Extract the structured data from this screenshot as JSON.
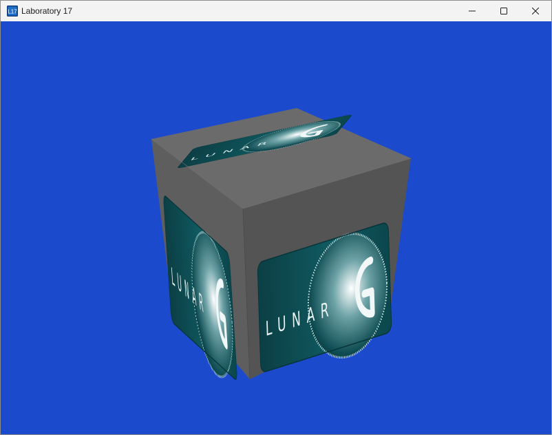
{
  "window": {
    "title": "Laboratory 17",
    "app_icon": "lab-app-icon",
    "caption_buttons": [
      "minimize-icon",
      "maximize-icon",
      "close-icon"
    ]
  },
  "scene": {
    "background_color": "#1c4acc",
    "cube_face_colors": {
      "top": "#6b6b6b",
      "left": "#5e5e5e",
      "right": "#545454"
    },
    "texture_text": "LUNAR",
    "texture_accent": "#0f4e54"
  }
}
